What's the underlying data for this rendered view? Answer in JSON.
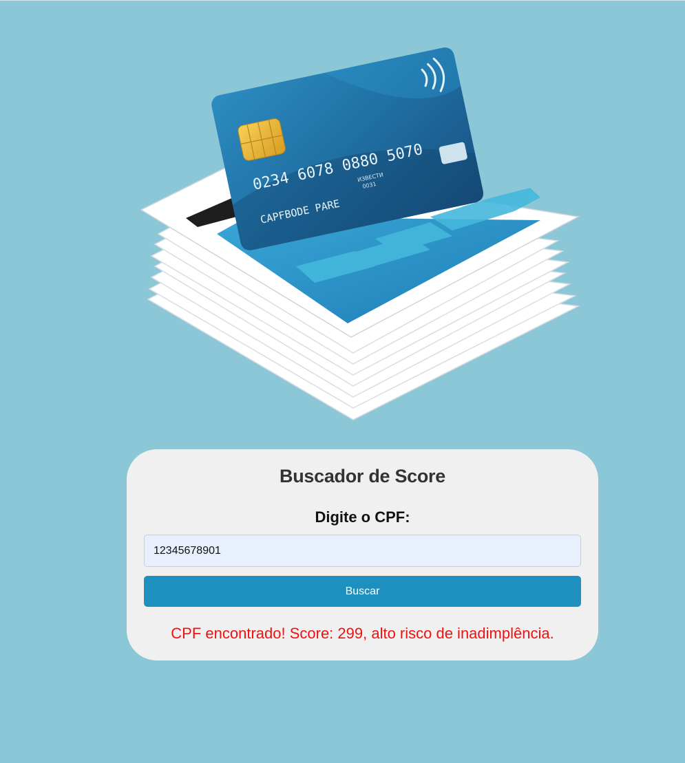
{
  "colors": {
    "background": "#8cc7d8",
    "panel": "#f0f0f0",
    "button": "#1e90bf",
    "result": "#f01010",
    "input_bg": "#e8f0fe"
  },
  "hero": {
    "illustration": "credit-card-on-paper-stack",
    "card_number": "0234  6078  0880  5070",
    "card_holder": "CAPFBODE PARE",
    "card_small_1": "ИЗВЕСТИ",
    "card_small_2": "0031"
  },
  "form": {
    "title": "Buscador de Score",
    "label": "Digite o CPF:",
    "cpf_value": "12345678901",
    "button_label": "Buscar"
  },
  "result": {
    "message": "CPF encontrado! Score: 299, alto risco de inadimplência."
  }
}
